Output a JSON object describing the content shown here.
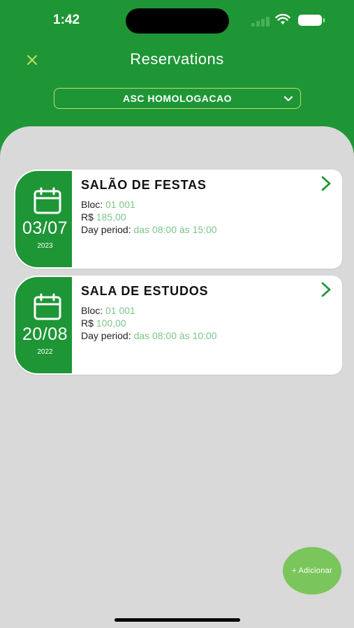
{
  "status_bar": {
    "time": "1:42"
  },
  "header": {
    "title": "Reservations",
    "close_icon": "close-icon",
    "selector_value": "ASC HOMOLOGACAO"
  },
  "reservations": [
    {
      "date": "03/07",
      "year": "2023",
      "title": "SALÃO DE FESTAS",
      "bloc_label": "Bloc:",
      "bloc_value": "01 001",
      "price_label": "R$",
      "price_value": "185,00",
      "period_label": "Day period:",
      "period_value": "das 08:00 às 15:00"
    },
    {
      "date": "20/08",
      "year": "2022",
      "title": "SALA DE ESTUDOS",
      "bloc_label": "Bloc:",
      "bloc_value": "01 001",
      "price_label": "R$",
      "price_value": "100,00",
      "period_label": "Day period:",
      "period_value": "das 08:00 às 10:00"
    }
  ],
  "fab": {
    "label": "+ Adicionar"
  },
  "colors": {
    "primary_green": "#1e9636",
    "accent_lime": "#c3dc6a",
    "value_green": "#7bc68a",
    "fab_green": "#7ac65c",
    "background_gray": "#d9d9d9"
  }
}
